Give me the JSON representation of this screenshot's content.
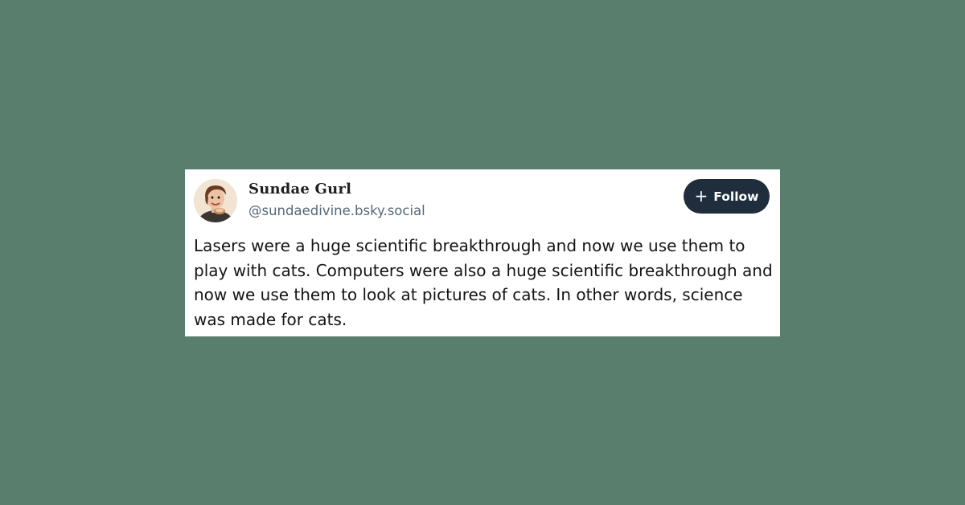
{
  "post": {
    "author": {
      "display_name": "Sundae Gurl",
      "handle": "@sundaedivine.bsky.social",
      "avatar_icon": "user-avatar"
    },
    "follow_button": {
      "icon": "plus-icon",
      "icon_glyph": "+",
      "label": "Follow"
    },
    "text": "Lasers were a huge scientific breakthrough and now we use them to play with cats. Computers were also a huge scientific breakthrough and now we use them to look at pictures of cats. In other words, science was made for cats."
  },
  "colors": {
    "background": "#5a7e6e",
    "card": "#ffffff",
    "follow_button": "#1f2d3d",
    "handle_text": "#55677a"
  }
}
